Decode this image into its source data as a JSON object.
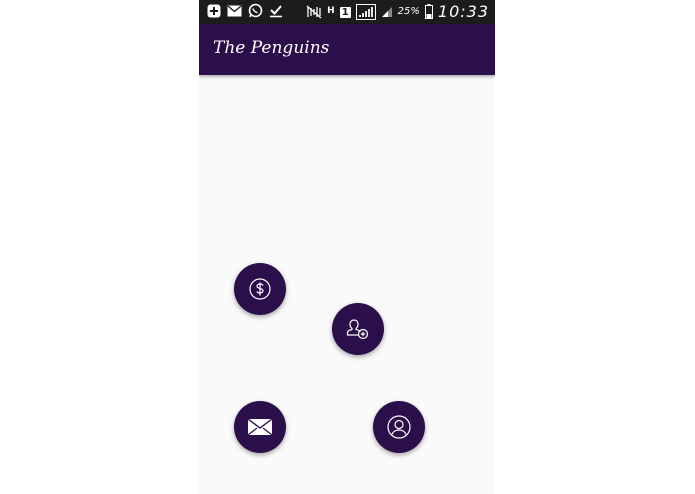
{
  "status_bar": {
    "left_icons": [
      "plus-box-icon",
      "mail-icon",
      "whatsapp-icon",
      "check-icon"
    ],
    "right_icons": [
      "mute-icon",
      "h-network-icon",
      "sim-1-icon",
      "signal-icon"
    ],
    "sim_label": "1",
    "network_label": "H",
    "battery_percent": "25%",
    "time": "10:33"
  },
  "app_bar": {
    "title": "The Penguins",
    "color": "#2a0f4a"
  },
  "fabs": [
    {
      "name": "payment",
      "icon": "dollar-circle-icon"
    },
    {
      "name": "add-user",
      "icon": "add-user-icon"
    },
    {
      "name": "message",
      "icon": "envelope-icon"
    },
    {
      "name": "profile",
      "icon": "user-circle-icon"
    }
  ],
  "colors": {
    "accent": "#2a0f4a",
    "background": "#fafafa",
    "status_bar": "#1c1c1c"
  }
}
